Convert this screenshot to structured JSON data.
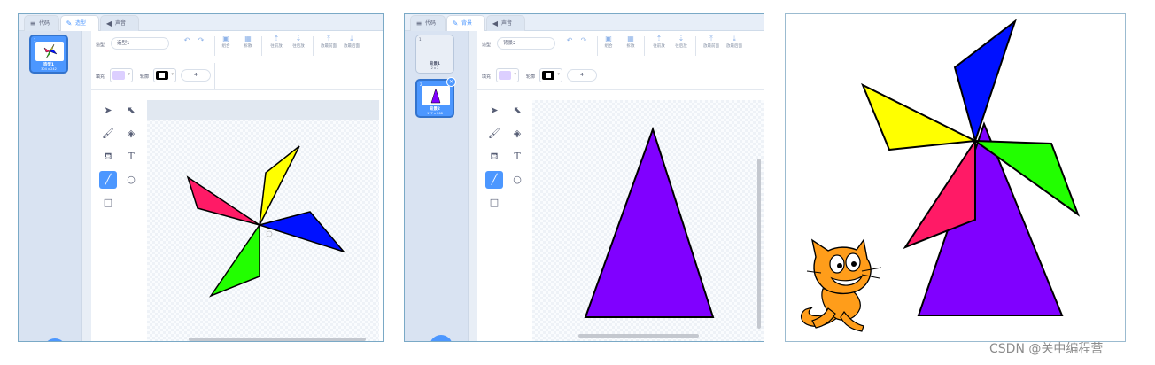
{
  "editor1": {
    "tabs": [
      {
        "label": "代码",
        "icon": "code-icon"
      },
      {
        "label": "造型",
        "icon": "brush-icon"
      },
      {
        "label": "声音",
        "icon": "speaker-icon"
      }
    ],
    "costume": {
      "number": "1",
      "name": "造型1",
      "size": "304 x 242"
    },
    "name_label": "造型",
    "name_value": "造型1",
    "fill_label": "填充",
    "outline_label": "轮廓",
    "outline_width": "4",
    "toolbar": [
      "组合",
      "拆散",
      "往前放",
      "往后放",
      "放最前面",
      "放最后面"
    ]
  },
  "editor2": {
    "tabs": [
      {
        "label": "代码",
        "icon": "code-icon"
      },
      {
        "label": "背景",
        "icon": "brush-icon"
      },
      {
        "label": "声音",
        "icon": "speaker-icon"
      }
    ],
    "backdrops": [
      {
        "number": "1",
        "name": "背景1",
        "size": "2 x 2"
      },
      {
        "number": "2",
        "name": "背景2",
        "size": "177 x 268"
      }
    ],
    "name_label": "造型",
    "name_value": "背景2",
    "fill_label": "填充",
    "outline_label": "轮廓",
    "outline_width": "4",
    "toolbar": [
      "组合",
      "拆散",
      "往前放",
      "往后放",
      "放最前面",
      "放最后面"
    ]
  },
  "colors": {
    "accent": "#4c97ff",
    "purple": "#8000ff",
    "yellow": "#ffff00",
    "blue": "#0011ff",
    "green": "#22ff00",
    "pink": "#ff1a66",
    "fill_swatch": "#dccfff"
  },
  "watermark": "CSDN @关中编程营"
}
